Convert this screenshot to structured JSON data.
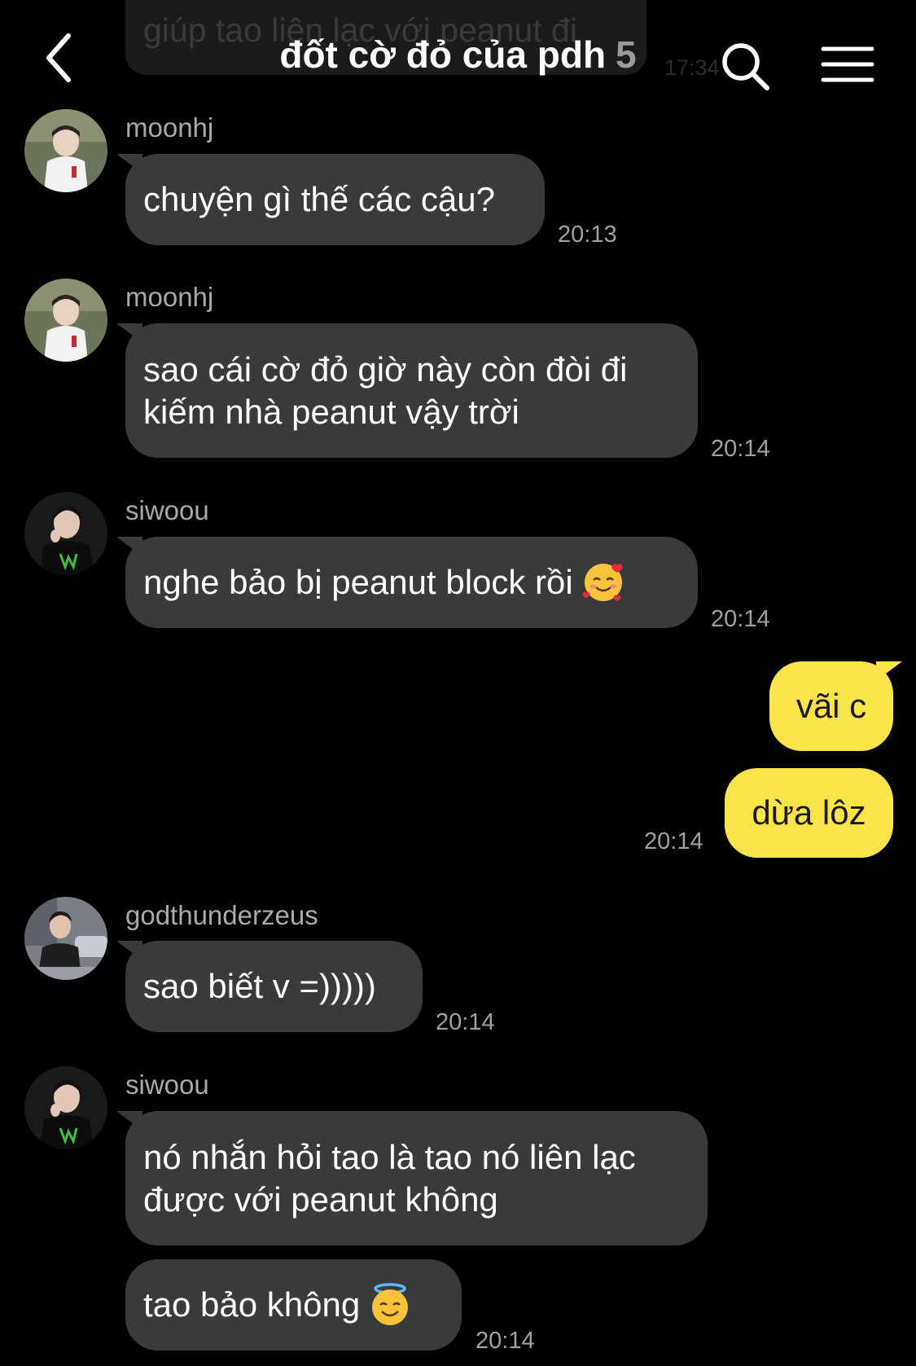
{
  "header": {
    "previous_message_preview": "giúp tao liên lạc với peanut đi",
    "previous_message_time": "17:34",
    "title": "đốt cờ đỏ của pdh",
    "member_count": "5",
    "back_icon": "chevron-left-icon",
    "search_icon": "search-icon",
    "menu_icon": "hamburger-menu-icon"
  },
  "messages": [
    {
      "sender": "moonhj",
      "text": "chuyện gì thế các cậu?",
      "time": "20:13"
    },
    {
      "sender": "moonhj",
      "text": "sao cái cờ đỏ giờ này còn đòi đi\nkiếm nhà peanut vậy trời",
      "time": "20:14"
    },
    {
      "sender": "siwoou",
      "text": "nghe bảo bị peanut block rồi",
      "emoji": "smiling-face-with-hearts-emoji",
      "time": "20:14"
    },
    {
      "sender": "me",
      "bubbles": [
        "vãi c",
        "dừa lôz"
      ],
      "time": "20:14"
    },
    {
      "sender": "godthunderzeus",
      "text": "sao biết v =)))))",
      "time": "20:14"
    },
    {
      "sender": "siwoou",
      "text": "nó nhắn hỏi tao là tao nó liên lạc\nđược với peanut không",
      "second_text": "tao bảo không",
      "second_emoji": "smiling-face-with-halo-emoji",
      "time": "20:14"
    }
  ],
  "colors": {
    "background": "#000000",
    "incoming_bubble": "#3a3a3c",
    "outgoing_bubble": "#f9e449",
    "timestamp": "#a0a0a0",
    "sender_name": "#a9a9a9"
  }
}
